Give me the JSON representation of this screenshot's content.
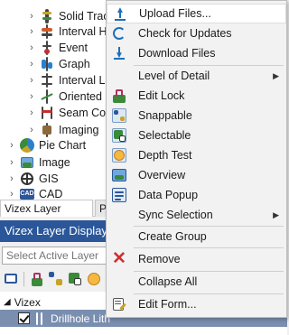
{
  "tree": {
    "items": [
      {
        "label": "Solid Trace",
        "icon": "solid-trace-icon"
      },
      {
        "label": "Interval Ha",
        "icon": "interval-icon"
      },
      {
        "label": "Event",
        "icon": "event-icon"
      },
      {
        "label": "Graph",
        "icon": "graph-icon"
      },
      {
        "label": "Interval La",
        "icon": "interval-label-icon"
      },
      {
        "label": "Oriented S",
        "icon": "oriented-icon"
      },
      {
        "label": "Seam Corr",
        "icon": "seam-icon"
      },
      {
        "label": "Imaging",
        "icon": "imaging-icon"
      }
    ],
    "top_items": [
      {
        "label": "Pie Chart",
        "icon": "pie-chart-icon"
      },
      {
        "label": "Image",
        "icon": "image-icon"
      },
      {
        "label": "GIS",
        "icon": "globe-icon"
      },
      {
        "label": "CAD",
        "icon": "cad-icon"
      }
    ]
  },
  "tabs": {
    "active": "Vizex Layer Types",
    "second": "Pr"
  },
  "layer_panel": {
    "title": "Vizex Layer Display",
    "search_placeholder": "Select Active Layer",
    "root_label": "Vizex",
    "selected_label": "Drillhole Lith"
  },
  "menu": {
    "items": [
      {
        "label": "Upload Files...",
        "icon": "upload-icon"
      },
      {
        "label": "Check for Updates",
        "icon": "refresh-icon"
      },
      {
        "label": "Download Files",
        "icon": "download-icon"
      },
      {
        "label": "Level of Detail",
        "icon": "",
        "submenu": true
      },
      {
        "label": "Edit Lock",
        "icon": "edit-lock-icon"
      },
      {
        "label": "Snappable",
        "icon": "snappable-icon"
      },
      {
        "label": "Selectable",
        "icon": "selectable-icon"
      },
      {
        "label": "Depth Test",
        "icon": "depth-test-icon"
      },
      {
        "label": "Overview",
        "icon": "overview-icon"
      },
      {
        "label": "Data Popup",
        "icon": "data-popup-icon"
      },
      {
        "label": "Sync Selection",
        "icon": "",
        "submenu": true
      },
      {
        "label": "Create Group",
        "icon": ""
      },
      {
        "label": "Remove",
        "icon": "remove-icon"
      },
      {
        "label": "Collapse All",
        "icon": ""
      },
      {
        "label": "Edit Form...",
        "icon": "edit-form-icon"
      }
    ]
  },
  "colors": {
    "header_blue": "#2b579a",
    "selection": "#7a8fb0",
    "remove_red": "#d03030",
    "accent_blue": "#1d6fb8"
  }
}
